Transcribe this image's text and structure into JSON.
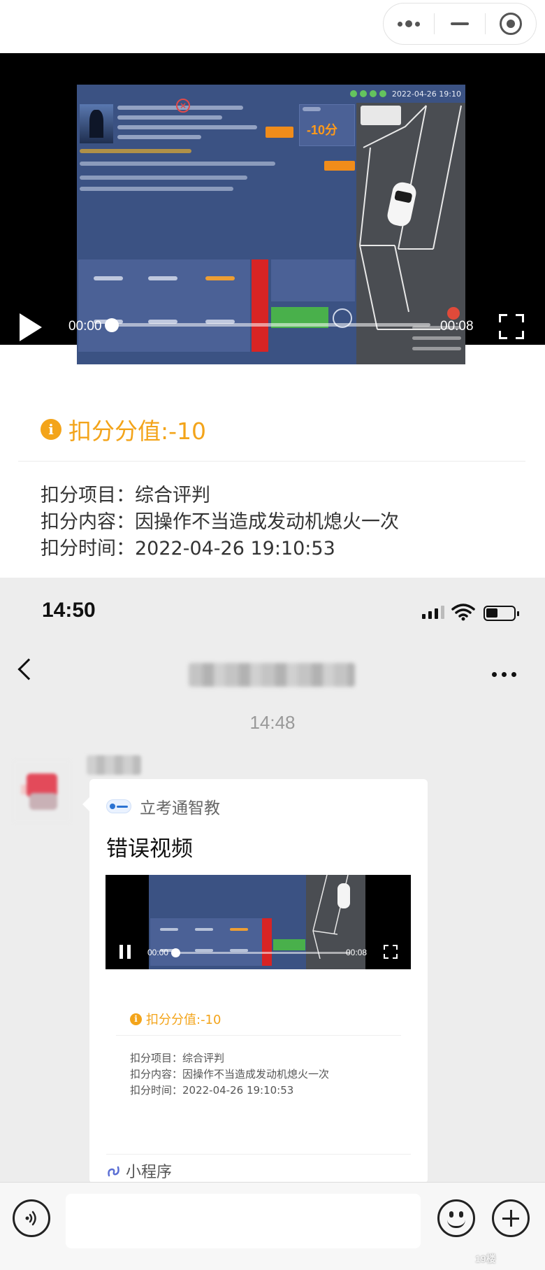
{
  "player": {
    "screen_datetime": "2022-04-26 19:10",
    "screen_score": "-10分",
    "time_current": "00:00",
    "time_total": "00:08",
    "progress": 0
  },
  "deduction": {
    "title": "扣分分值:-10",
    "item": "扣分项目：综合评判",
    "content": "扣分内容：因操作不当造成发动机熄火一次",
    "time": "扣分时间：2022-04-26 19:10:53"
  },
  "status_bar": {
    "time": "14:50"
  },
  "chat": {
    "message_time": "14:48",
    "card": {
      "source": "立考通智教",
      "title": "错误视频",
      "video": {
        "time_current": "00:00",
        "time_total": "00:08",
        "progress": 0
      },
      "deduction": {
        "title": "扣分分值:-10",
        "item": "扣分项目：综合评判",
        "content": "扣分内容：因操作不当造成发动机熄火一次",
        "time": "扣分时间：2022-04-26 19:10:53"
      },
      "footer": "小程序"
    }
  },
  "colors": {
    "accent_orange": "#f3a41a",
    "chat_bg": "#ededed"
  },
  "icons": [
    "more-dots-icon",
    "minimize-icon",
    "close-target-icon",
    "play-icon",
    "fullscreen-icon",
    "info-icon",
    "signal-icon",
    "wifi-icon",
    "battery-icon",
    "back-chevron-icon",
    "pause-icon",
    "mini-program-icon",
    "voice-icon",
    "emoji-icon",
    "plus-icon"
  ],
  "watermark": "19楼"
}
